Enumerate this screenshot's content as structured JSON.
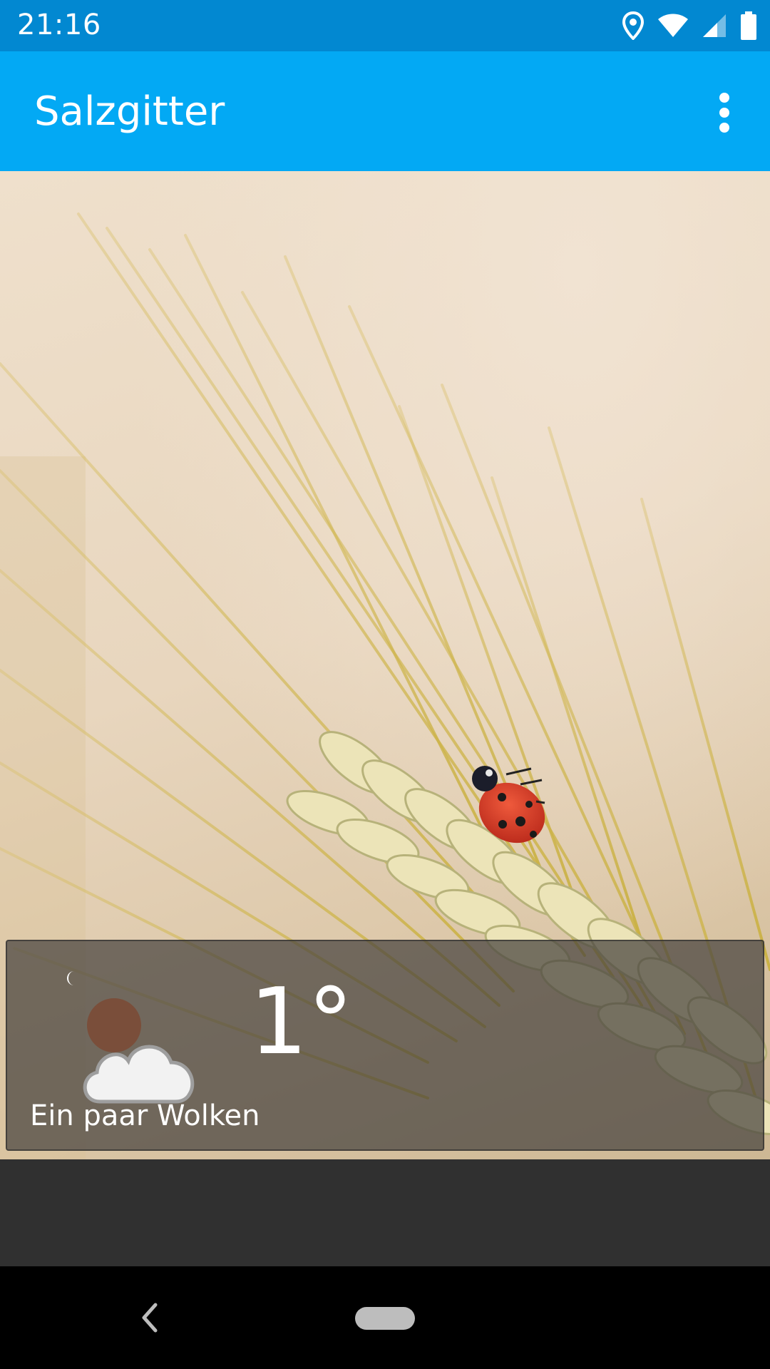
{
  "status_bar": {
    "time": "21:16",
    "icons": [
      "location-icon",
      "wifi-icon",
      "cell-signal-icon",
      "battery-icon"
    ]
  },
  "app_bar": {
    "title": "Salzgitter",
    "menu_icon": "more-vert-icon"
  },
  "weather": {
    "temperature": "1°",
    "condition": "Ein paar Wolken",
    "icon": "moon-partly-cloudy-icon"
  },
  "nav_bar": {
    "icons": [
      "back-icon",
      "home-pill-icon"
    ]
  },
  "colors": {
    "status_bar": "#0288d1",
    "app_bar": "#03a9f4",
    "card_bg": "#46423e",
    "dark_strip": "#303030"
  }
}
